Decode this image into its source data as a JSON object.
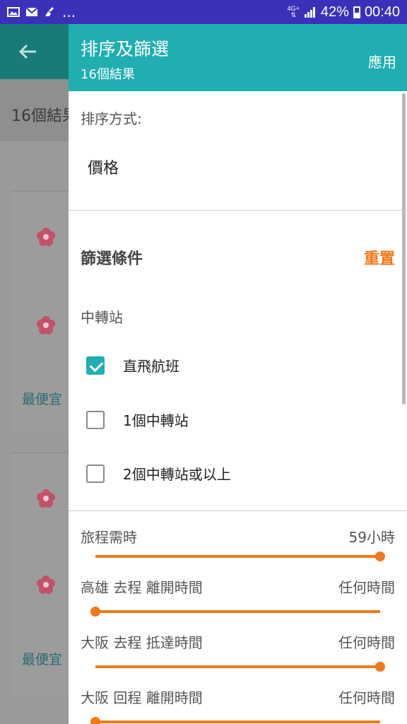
{
  "status_bar": {
    "network": "4G+",
    "battery": "42%",
    "time": "00:40",
    "overflow": "..."
  },
  "background": {
    "results_count": "16個結果",
    "cheapest_label_1": "最便宜",
    "cheapest_label_2": "最便宜"
  },
  "drawer": {
    "title": "排序及篩選",
    "subtitle": "16個結果",
    "apply_label": "應用",
    "sort": {
      "label": "排序方式:",
      "value": "價格"
    },
    "filters": {
      "title": "篩選條件",
      "reset_label": "重置",
      "stops_label": "中轉站",
      "options": [
        {
          "label": "直飛航班",
          "checked": true
        },
        {
          "label": "1個中轉站",
          "checked": false
        },
        {
          "label": "2個中轉站或以上",
          "checked": false
        }
      ],
      "sliders": [
        {
          "label": "旅程需時",
          "value": "59小時",
          "level": 1.0
        },
        {
          "label": "高雄  去程 離開時間",
          "value": "任何時間",
          "level": 0.0
        },
        {
          "label": "大阪  去程 抵達時間",
          "value": "任何時間",
          "level": 1.0
        },
        {
          "label": "大阪  回程 離開時間",
          "value": "任何時間",
          "level": 0.0
        }
      ]
    }
  },
  "colors": {
    "accent_teal": "#21aeb0",
    "accent_orange": "#f07a1b",
    "status_bar": "#3b31b8"
  }
}
